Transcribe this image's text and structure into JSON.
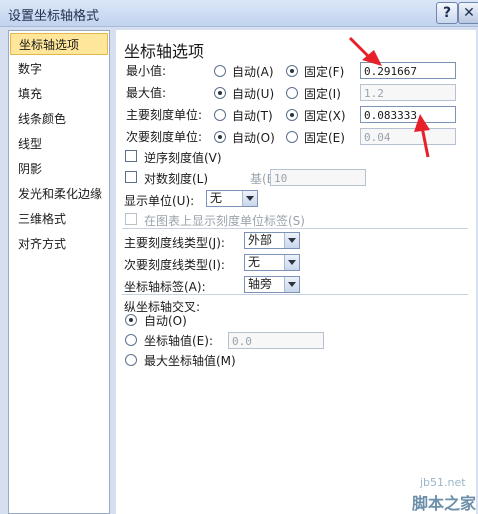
{
  "window": {
    "title": "设置坐标轴格式",
    "help_label": "?",
    "close_label": "✕"
  },
  "sidebar": {
    "items": [
      {
        "label": "坐标轴选项",
        "selected": true
      },
      {
        "label": "数字"
      },
      {
        "label": "填充"
      },
      {
        "label": "线条颜色"
      },
      {
        "label": "线型"
      },
      {
        "label": "阴影"
      },
      {
        "label": "发光和柔化边缘"
      },
      {
        "label": "三维格式"
      },
      {
        "label": "对齐方式"
      }
    ]
  },
  "panel": {
    "heading": "坐标轴选项",
    "rows": [
      {
        "label": "最小值:",
        "auto": "自动(A)",
        "fixed": "固定(F)",
        "value": "0.291667",
        "selected": "fixed"
      },
      {
        "label": "最大值:",
        "auto": "自动(U)",
        "fixed": "固定(I)",
        "value": "1.2",
        "selected": "auto"
      },
      {
        "label": "主要刻度单位:",
        "auto": "自动(T)",
        "fixed": "固定(X)",
        "value": "0.083333",
        "selected": "fixed"
      },
      {
        "label": "次要刻度单位:",
        "auto": "自动(O)",
        "fixed": "固定(E)",
        "value": "0.04",
        "selected": "auto"
      }
    ],
    "reverse_label": "逆序刻度值(V)",
    "log_label": "对数刻度(L)",
    "base_label": "基(B):",
    "base_value": "10",
    "display_unit_label": "显示单位(U):",
    "display_unit_value": "无",
    "show_unit_label": "在图表上显示刻度单位标签(S)",
    "major_tick_label": "主要刻度线类型(J):",
    "major_tick_value": "外部",
    "minor_tick_label": "次要刻度线类型(I):",
    "minor_tick_value": "无",
    "axis_label_label": "坐标轴标签(A):",
    "axis_label_value": "轴旁",
    "cross_heading": "纵坐标轴交叉:",
    "cross_auto": "自动(O)",
    "cross_value_label": "坐标轴值(E):",
    "cross_value": "0.0",
    "cross_max": "最大坐标轴值(M)"
  },
  "watermark": {
    "site": "jb51.net",
    "name": "脚本之家"
  },
  "colors": {
    "arrow": "#e8202a",
    "selection": "#ffe69a"
  }
}
